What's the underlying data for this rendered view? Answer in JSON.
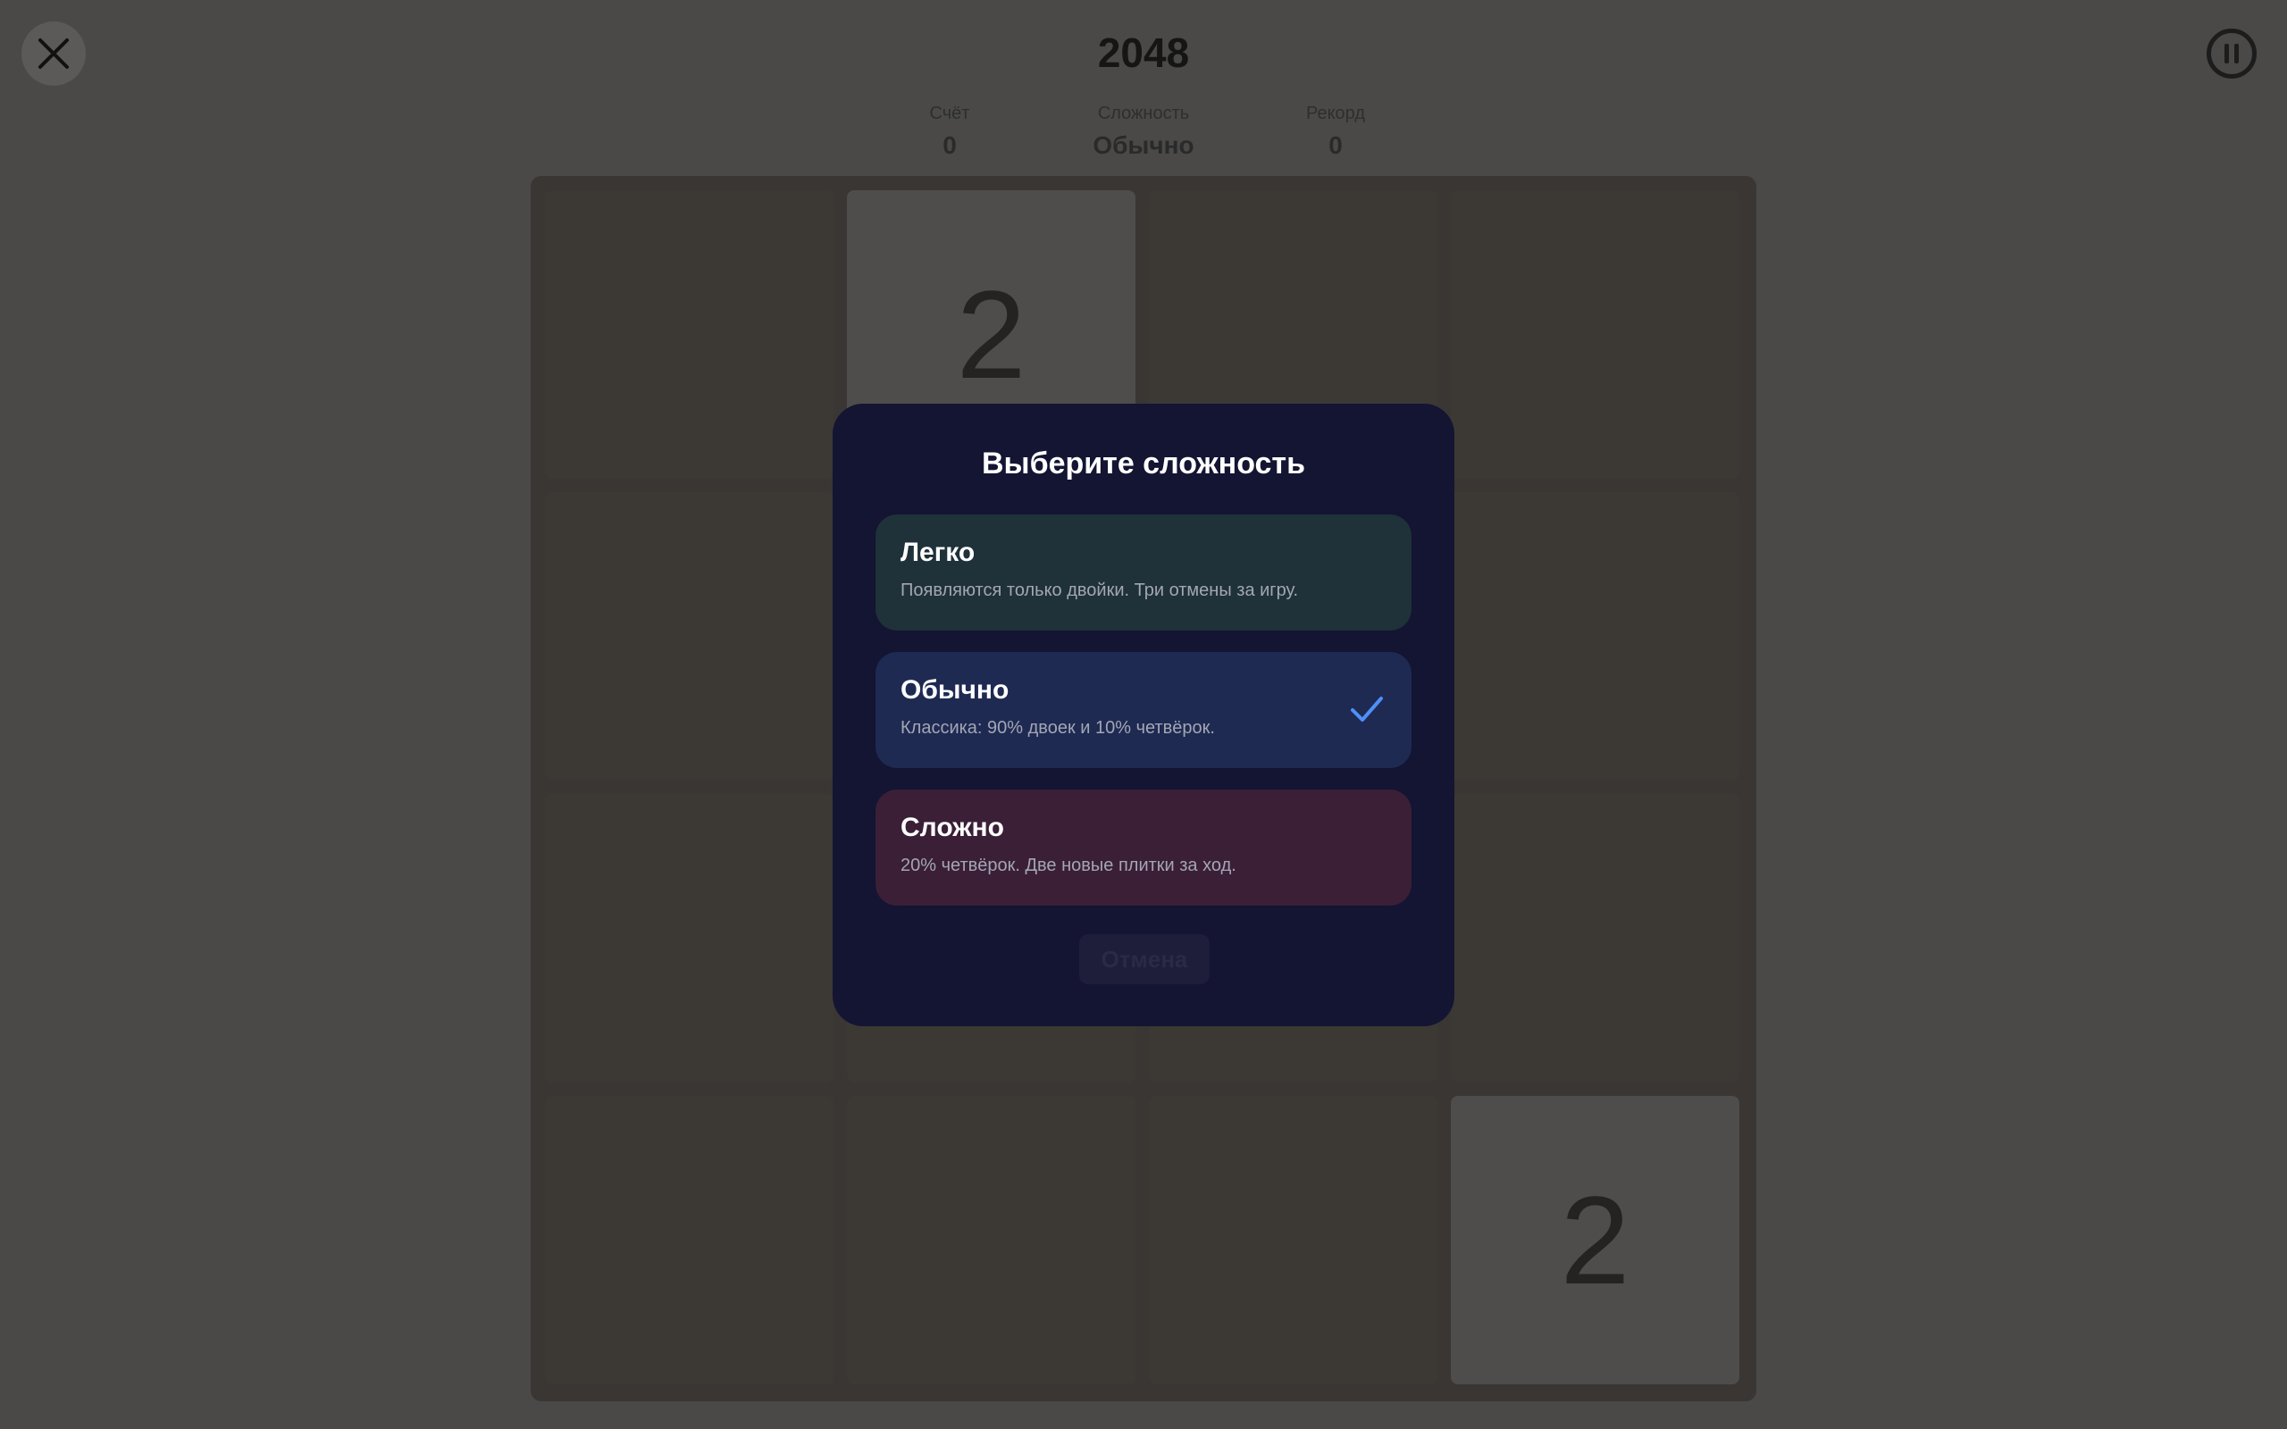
{
  "header": {
    "title": "2048",
    "close_icon": "close-icon",
    "pause_icon": "pause-icon"
  },
  "stats": {
    "score_label": "Счёт",
    "score_value": "0",
    "difficulty_label": "Сложность",
    "difficulty_value": "Обычно",
    "record_label": "Рекорд",
    "record_value": "0"
  },
  "board": {
    "size": 4,
    "tiles": [
      [
        "",
        "2",
        "",
        ""
      ],
      [
        "",
        "",
        "",
        ""
      ],
      [
        "",
        "",
        "",
        ""
      ],
      [
        "",
        "",
        "",
        "2"
      ]
    ]
  },
  "modal": {
    "title": "Выберите сложность",
    "options": [
      {
        "name": "Легко",
        "desc": "Появляются только двойки. Три отмены за игру.",
        "selected": false,
        "color": "#1f3139"
      },
      {
        "name": "Обычно",
        "desc": "Классика: 90% двоек и 10% четвёрок.",
        "selected": true,
        "color": "#1e2a52"
      },
      {
        "name": "Сложно",
        "desc": "20% четвёрок. Две новые плитки за ход.",
        "selected": false,
        "color": "#3a1f37"
      }
    ],
    "cancel_label": "Отмена",
    "check_icon": "check-icon",
    "accent_color": "#4f8ff7"
  }
}
